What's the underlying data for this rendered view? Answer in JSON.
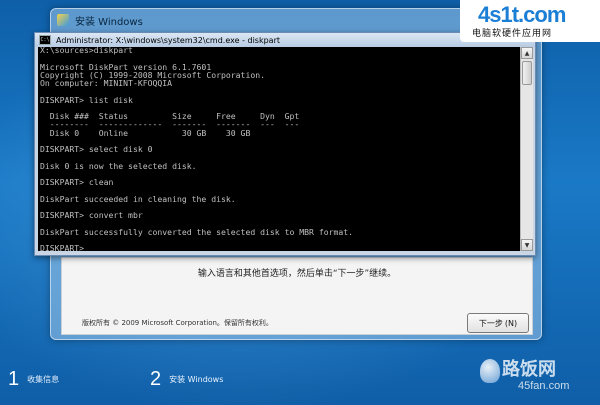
{
  "setup_window": {
    "title": "安装 Windows",
    "instruction": "输入语言和其他首选项，然后单击“下一步”继续。",
    "copyright": "版权所有 © 2009 Microsoft Corporation。保留所有权利。",
    "next_button": "下一步",
    "next_underline": "(N)"
  },
  "cmd_window": {
    "title": "Administrator: X:\\windows\\system32\\cmd.exe - diskpart",
    "lines": [
      "X:\\sources>diskpart",
      "",
      "Microsoft DiskPart version 6.1.7601",
      "Copyright (C) 1999-2008 Microsoft Corporation.",
      "On computer: MININT-KFOQQIA",
      "",
      "DISKPART> list disk",
      "",
      "  Disk ###  Status         Size     Free     Dyn  Gpt",
      "  --------  -------------  -------  -------  ---  ---",
      "  Disk 0    Online           30 GB    30 GB",
      "",
      "DISKPART> select disk 0",
      "",
      "Disk 0 is now the selected disk.",
      "",
      "DISKPART> clean",
      "",
      "DiskPart succeeded in cleaning the disk.",
      "",
      "DISKPART> convert mbr",
      "",
      "DiskPart successfully converted the selected disk to MBR format.",
      "",
      "DISKPART>"
    ]
  },
  "steps": [
    {
      "number": "1",
      "label": "收集信息"
    },
    {
      "number": "2",
      "label": "安装 Windows"
    }
  ],
  "watermarks": {
    "top_logo": "4s1t.com",
    "top_sub": "电脑软硬件应用网",
    "bottom_main": "路饭网",
    "bottom_sub": "45fan.com"
  }
}
